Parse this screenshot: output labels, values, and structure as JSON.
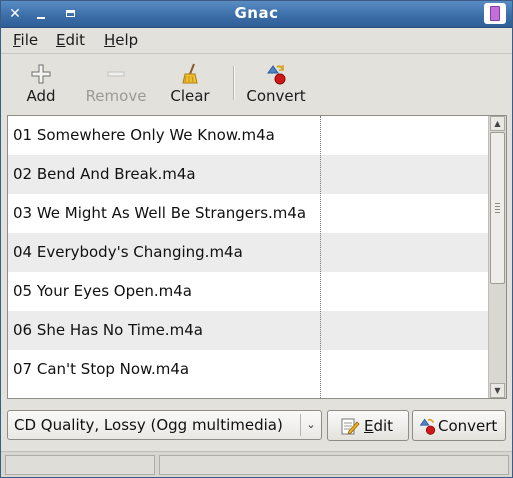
{
  "window": {
    "title": "Gnac"
  },
  "menubar": {
    "file": {
      "mnemonic": "F",
      "rest": "ile"
    },
    "edit": {
      "mnemonic": "E",
      "rest": "dit"
    },
    "help": {
      "mnemonic": "H",
      "rest": "elp"
    }
  },
  "toolbar": {
    "add": {
      "label": "Add",
      "icon": "plus-icon",
      "enabled": true
    },
    "remove": {
      "label": "Remove",
      "icon": "minus-icon",
      "enabled": false
    },
    "clear": {
      "label": "Clear",
      "icon": "broom-icon",
      "enabled": true
    },
    "convert": {
      "label": "Convert",
      "icon": "convert-icon",
      "enabled": true
    }
  },
  "files": [
    "01 Somewhere Only We Know.m4a",
    "02 Bend And Break.m4a",
    "03 We Might As Well Be Strangers.m4a",
    "04 Everybody's Changing.m4a",
    "05 Your Eyes Open.m4a",
    "06 She Has No Time.m4a",
    "07 Can't Stop Now.m4a"
  ],
  "profile": {
    "selected": "CD Quality, Lossy (Ogg multimedia)"
  },
  "buttons": {
    "edit": {
      "mnemonic": "E",
      "rest": "dit"
    },
    "convert": {
      "label": "Convert"
    }
  },
  "colors": {
    "titlebar": "#3c6ea8",
    "row_alt": "#ececec",
    "window_bg": "#e2e1dc"
  }
}
